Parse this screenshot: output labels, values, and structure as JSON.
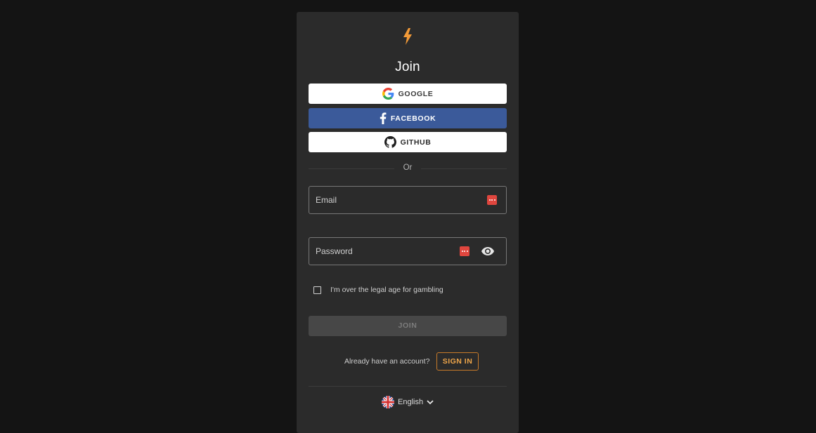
{
  "page": {
    "title": "Join"
  },
  "social": {
    "google_label": "GOOGLE",
    "facebook_label": "FACEBOOK",
    "github_label": "GITHUB"
  },
  "divider_text": "Or",
  "form": {
    "email_placeholder": "Email",
    "password_placeholder": "Password",
    "age_checkbox_label": "I'm over the legal age for gambling",
    "age_checkbox_checked": false,
    "join_label": "JOIN"
  },
  "signin": {
    "prompt": "Already have an account?",
    "button_label": "SIGN IN"
  },
  "language": {
    "selected": "English"
  },
  "icons": {
    "logo": "lightning-bolt-icon",
    "google": "google-icon",
    "facebook": "facebook-icon",
    "github": "github-icon",
    "password_manager": "password-manager-icon",
    "show_password": "eye-icon",
    "flag": "uk-flag-icon",
    "chevron": "chevron-down-icon"
  },
  "colors": {
    "background": "#141414",
    "card": "#2b2b2b",
    "accent": "#f0a64a",
    "facebook": "#3b5a9a",
    "password_manager": "#e0463e"
  }
}
